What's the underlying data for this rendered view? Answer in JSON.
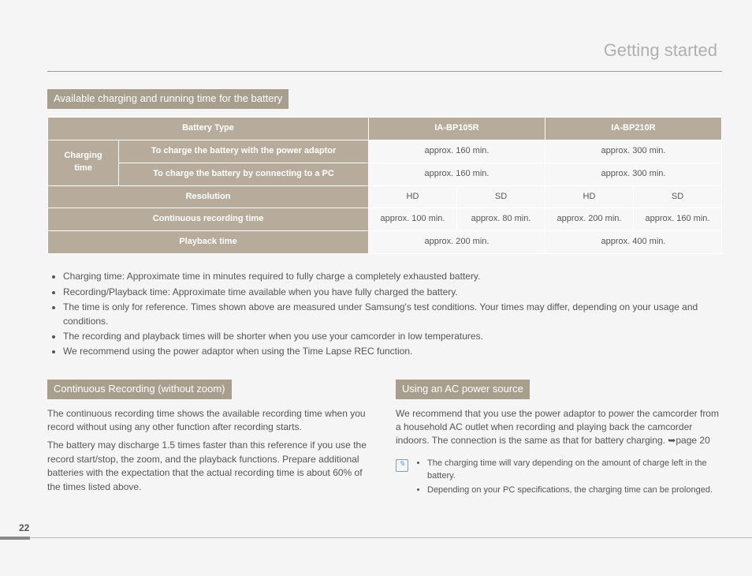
{
  "page_title": "Getting started",
  "page_number": "22",
  "section1": {
    "heading": "Available charging and running time for the battery"
  },
  "table": {
    "h_battery_type": "Battery Type",
    "h_bp105r": "IA-BP105R",
    "h_bp210r": "IA-BP210R",
    "h_charging": "Charging time",
    "h_adaptor": "To charge the battery with the power adaptor",
    "h_pc": "To charge the battery by connecting to a PC",
    "h_resolution": "Resolution",
    "h_continuous": "Continuous recording time",
    "h_playback": "Playback time",
    "v_160": "approx. 160 min.",
    "v_300": "approx. 300 min.",
    "v_hd": "HD",
    "v_sd": "SD",
    "v_100": "approx. 100 min.",
    "v_80": "approx. 80 min.",
    "v_200": "approx. 200 min.",
    "v_400": "approx. 400 min."
  },
  "notes": {
    "n1": "Charging time: Approximate time in minutes required to fully charge a completely exhausted battery.",
    "n2": "Recording/Playback time: Approximate time available when you have fully charged the battery.",
    "n3": "The time is only for reference. Times shown above are measured under Samsung's test conditions. Your times may differ, depending on your usage and conditions.",
    "n4": "The recording and playback times will be shorter when you use your camcorder in low temperatures.",
    "n5": "We recommend using the power adaptor when using the Time Lapse REC function."
  },
  "col_left": {
    "heading": "Continuous Recording (without zoom)",
    "p1": "The continuous recording time shows the available recording time when you record without using any other function after recording starts.",
    "p2": "The battery may discharge 1.5 times faster than this reference if you use the record start/stop, the zoom, and the playback functions. Prepare additional batteries with the expectation that the actual recording time is about 60% of the times listed above."
  },
  "col_right": {
    "heading": "Using an AC power source",
    "p1": "We recommend that you use the power adaptor to power the camcorder from a household AC outlet when recording and playing back the camcorder indoors. The connection is the same as that for battery charging. ➥page 20",
    "note1": "The charging time will vary depending on the amount of charge left in the battery.",
    "note2": "Depending on your PC specifications, the charging time can be prolonged."
  }
}
